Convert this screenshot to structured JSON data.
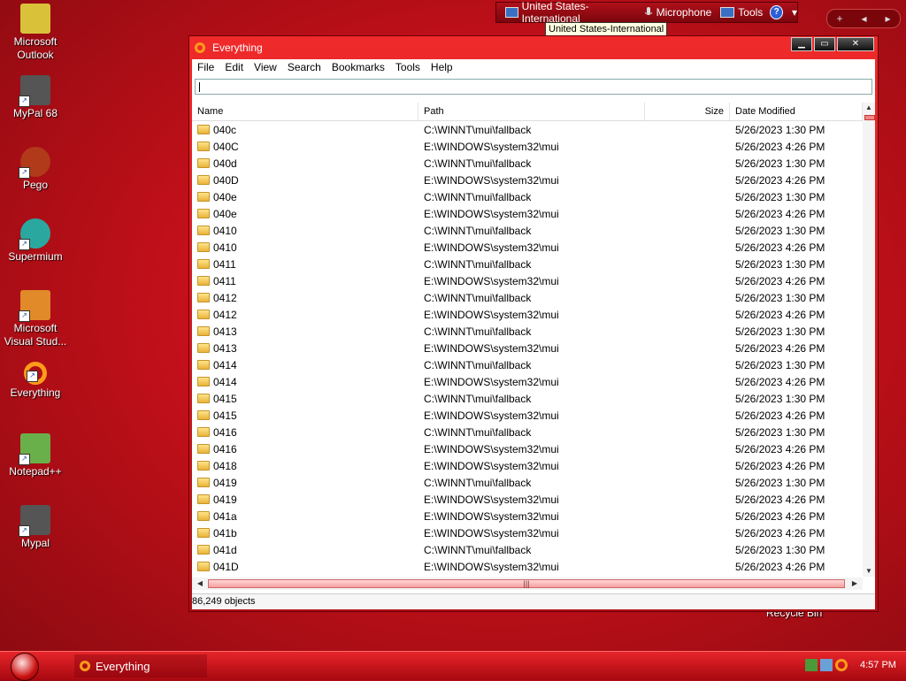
{
  "desktop": {
    "icons": [
      {
        "label": "Microsoft Outlook",
        "icon": "outlook-icon"
      },
      {
        "label": "MyPal 68",
        "icon": "mypal-icon"
      },
      {
        "label": "Pego",
        "icon": "pego-icon"
      },
      {
        "label": "Supermium",
        "icon": "supermium-icon"
      },
      {
        "label": "Microsoft Visual Stud...",
        "icon": "visual-studio-icon"
      },
      {
        "label": "Everything",
        "icon": "everything-icon"
      },
      {
        "label": "Notepad++",
        "icon": "notepadpp-icon"
      },
      {
        "label": "Mypal",
        "icon": "mypal-icon"
      }
    ],
    "recycle_bin": "Recycle Bin"
  },
  "langbar": {
    "language": "United States-International",
    "microphone": "Microphone",
    "tools": "Tools",
    "help": "?",
    "tooltip": "United States-International"
  },
  "window": {
    "title": "Everything",
    "menu": [
      "File",
      "Edit",
      "View",
      "Search",
      "Bookmarks",
      "Tools",
      "Help"
    ],
    "search_value": "",
    "columns": {
      "name": "Name",
      "path": "Path",
      "size": "Size",
      "date": "Date Modified"
    },
    "rows": [
      {
        "name": "040c",
        "path": "C:\\WINNT\\mui\\fallback",
        "size": "",
        "date": "5/26/2023 1:30 PM"
      },
      {
        "name": "040C",
        "path": "E:\\WINDOWS\\system32\\mui",
        "size": "",
        "date": "5/26/2023 4:26 PM"
      },
      {
        "name": "040d",
        "path": "C:\\WINNT\\mui\\fallback",
        "size": "",
        "date": "5/26/2023 1:30 PM"
      },
      {
        "name": "040D",
        "path": "E:\\WINDOWS\\system32\\mui",
        "size": "",
        "date": "5/26/2023 4:26 PM"
      },
      {
        "name": "040e",
        "path": "C:\\WINNT\\mui\\fallback",
        "size": "",
        "date": "5/26/2023 1:30 PM"
      },
      {
        "name": "040e",
        "path": "E:\\WINDOWS\\system32\\mui",
        "size": "",
        "date": "5/26/2023 4:26 PM"
      },
      {
        "name": "0410",
        "path": "C:\\WINNT\\mui\\fallback",
        "size": "",
        "date": "5/26/2023 1:30 PM"
      },
      {
        "name": "0410",
        "path": "E:\\WINDOWS\\system32\\mui",
        "size": "",
        "date": "5/26/2023 4:26 PM"
      },
      {
        "name": "0411",
        "path": "C:\\WINNT\\mui\\fallback",
        "size": "",
        "date": "5/26/2023 1:30 PM"
      },
      {
        "name": "0411",
        "path": "E:\\WINDOWS\\system32\\mui",
        "size": "",
        "date": "5/26/2023 4:26 PM"
      },
      {
        "name": "0412",
        "path": "C:\\WINNT\\mui\\fallback",
        "size": "",
        "date": "5/26/2023 1:30 PM"
      },
      {
        "name": "0412",
        "path": "E:\\WINDOWS\\system32\\mui",
        "size": "",
        "date": "5/26/2023 4:26 PM"
      },
      {
        "name": "0413",
        "path": "C:\\WINNT\\mui\\fallback",
        "size": "",
        "date": "5/26/2023 1:30 PM"
      },
      {
        "name": "0413",
        "path": "E:\\WINDOWS\\system32\\mui",
        "size": "",
        "date": "5/26/2023 4:26 PM"
      },
      {
        "name": "0414",
        "path": "C:\\WINNT\\mui\\fallback",
        "size": "",
        "date": "5/26/2023 1:30 PM"
      },
      {
        "name": "0414",
        "path": "E:\\WINDOWS\\system32\\mui",
        "size": "",
        "date": "5/26/2023 4:26 PM"
      },
      {
        "name": "0415",
        "path": "C:\\WINNT\\mui\\fallback",
        "size": "",
        "date": "5/26/2023 1:30 PM"
      },
      {
        "name": "0415",
        "path": "E:\\WINDOWS\\system32\\mui",
        "size": "",
        "date": "5/26/2023 4:26 PM"
      },
      {
        "name": "0416",
        "path": "C:\\WINNT\\mui\\fallback",
        "size": "",
        "date": "5/26/2023 1:30 PM"
      },
      {
        "name": "0416",
        "path": "E:\\WINDOWS\\system32\\mui",
        "size": "",
        "date": "5/26/2023 4:26 PM"
      },
      {
        "name": "0418",
        "path": "E:\\WINDOWS\\system32\\mui",
        "size": "",
        "date": "5/26/2023 4:26 PM"
      },
      {
        "name": "0419",
        "path": "C:\\WINNT\\mui\\fallback",
        "size": "",
        "date": "5/26/2023 1:30 PM"
      },
      {
        "name": "0419",
        "path": "E:\\WINDOWS\\system32\\mui",
        "size": "",
        "date": "5/26/2023 4:26 PM"
      },
      {
        "name": "041a",
        "path": "E:\\WINDOWS\\system32\\mui",
        "size": "",
        "date": "5/26/2023 4:26 PM"
      },
      {
        "name": "041b",
        "path": "E:\\WINDOWS\\system32\\mui",
        "size": "",
        "date": "5/26/2023 4:26 PM"
      },
      {
        "name": "041d",
        "path": "C:\\WINNT\\mui\\fallback",
        "size": "",
        "date": "5/26/2023 1:30 PM"
      },
      {
        "name": "041D",
        "path": "E:\\WINDOWS\\system32\\mui",
        "size": "",
        "date": "5/26/2023 4:26 PM"
      }
    ],
    "status": "86,249 objects"
  },
  "taskbar": {
    "task_label": "Everything",
    "clock": "4:57 PM"
  }
}
